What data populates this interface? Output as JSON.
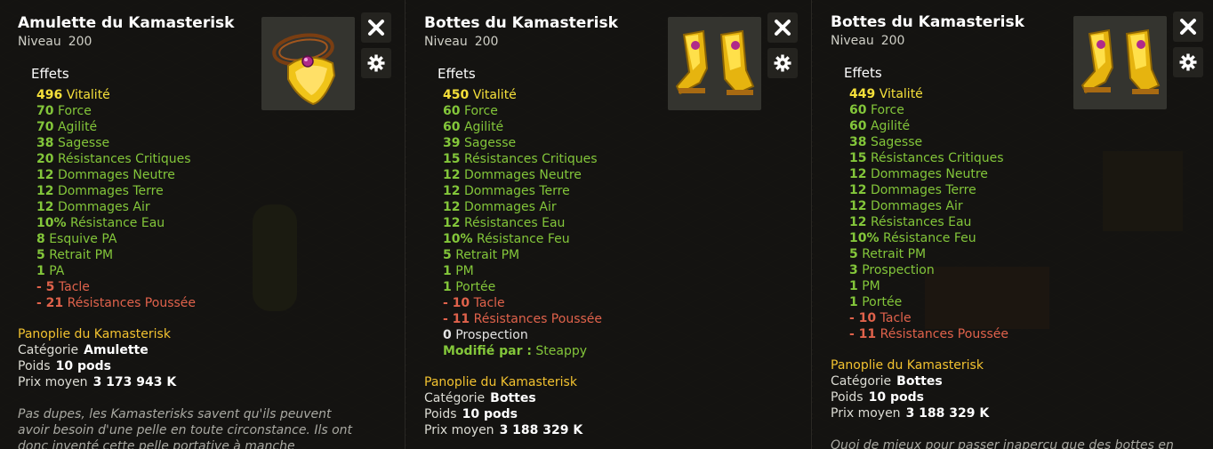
{
  "colors": {
    "stat_green": "#83c63a",
    "vitality_yellow": "#f5e03a",
    "malus_red": "#e0624b",
    "set_gold": "#f2c230"
  },
  "tooltips": [
    {
      "name": "Amulette du Kamasterisk",
      "level_label": "Niveau",
      "level": "200",
      "effects_label": "Effets",
      "icon": "golden-amulet-icon",
      "effects": [
        {
          "value": "496",
          "label": "Vitalité",
          "color": "yellow"
        },
        {
          "value": "70",
          "label": "Force",
          "color": "green"
        },
        {
          "value": "70",
          "label": "Agilité",
          "color": "green"
        },
        {
          "value": "38",
          "label": "Sagesse",
          "color": "green"
        },
        {
          "value": "20",
          "label": "Résistances Critiques",
          "color": "green"
        },
        {
          "value": "12",
          "label": "Dommages Neutre",
          "color": "green"
        },
        {
          "value": "12",
          "label": "Dommages Terre",
          "color": "green"
        },
        {
          "value": "12",
          "label": "Dommages Air",
          "color": "green"
        },
        {
          "value": "10%",
          "label": "Résistance Eau",
          "color": "green"
        },
        {
          "value": "8",
          "label": "Esquive PA",
          "color": "green"
        },
        {
          "value": "5",
          "label": "Retrait PM",
          "color": "green"
        },
        {
          "value": "1",
          "label": "PA",
          "color": "green"
        },
        {
          "value": "- 5",
          "label": "Tacle",
          "color": "red"
        },
        {
          "value": "- 21",
          "label": "Résistances Poussée",
          "color": "red"
        }
      ],
      "set_name": "Panoplie du Kamasterisk",
      "category_label": "Catégorie",
      "category": "Amulette",
      "weight_label": "Poids",
      "weight": "10 pods",
      "price_label": "Prix moyen",
      "price": "3 173 943 K",
      "description": "Pas dupes, les Kamasterisks savent qu'ils peuvent avoir besoin d'une pelle en toute circonstance. Ils ont donc inventé cette pelle portative à manche rétractable pour ne"
    },
    {
      "name": "Bottes du Kamasterisk",
      "level_label": "Niveau",
      "level": "200",
      "effects_label": "Effets",
      "icon": "golden-boots-icon",
      "effects": [
        {
          "value": "450",
          "label": "Vitalité",
          "color": "yellow"
        },
        {
          "value": "60",
          "label": "Force",
          "color": "green"
        },
        {
          "value": "60",
          "label": "Agilité",
          "color": "green"
        },
        {
          "value": "39",
          "label": "Sagesse",
          "color": "green"
        },
        {
          "value": "15",
          "label": "Résistances Critiques",
          "color": "green"
        },
        {
          "value": "12",
          "label": "Dommages Neutre",
          "color": "green"
        },
        {
          "value": "12",
          "label": "Dommages Terre",
          "color": "green"
        },
        {
          "value": "12",
          "label": "Dommages Air",
          "color": "green"
        },
        {
          "value": "12",
          "label": "Résistances Eau",
          "color": "green"
        },
        {
          "value": "10%",
          "label": "Résistance Feu",
          "color": "green"
        },
        {
          "value": "5",
          "label": "Retrait PM",
          "color": "green"
        },
        {
          "value": "1",
          "label": "PM",
          "color": "green"
        },
        {
          "value": "1",
          "label": "Portée",
          "color": "green"
        },
        {
          "value": "- 10",
          "label": "Tacle",
          "color": "red"
        },
        {
          "value": "- 11",
          "label": "Résistances Poussée",
          "color": "red"
        },
        {
          "value": "0",
          "label": "Prospection",
          "color": "white"
        },
        {
          "value": "Modifié par :",
          "label": "Steappy",
          "color": "green"
        }
      ],
      "set_name": "Panoplie du Kamasterisk",
      "category_label": "Catégorie",
      "category": "Bottes",
      "weight_label": "Poids",
      "weight": "10 pods",
      "price_label": "Prix moyen",
      "price": "3 188 329 K",
      "description": ""
    },
    {
      "name": "Bottes du Kamasterisk",
      "level_label": "Niveau",
      "level": "200",
      "effects_label": "Effets",
      "icon": "golden-boots-icon",
      "effects": [
        {
          "value": "449",
          "label": "Vitalité",
          "color": "yellow"
        },
        {
          "value": "60",
          "label": "Force",
          "color": "green"
        },
        {
          "value": "60",
          "label": "Agilité",
          "color": "green"
        },
        {
          "value": "38",
          "label": "Sagesse",
          "color": "green"
        },
        {
          "value": "15",
          "label": "Résistances Critiques",
          "color": "green"
        },
        {
          "value": "12",
          "label": "Dommages Neutre",
          "color": "green"
        },
        {
          "value": "12",
          "label": "Dommages Terre",
          "color": "green"
        },
        {
          "value": "12",
          "label": "Dommages Air",
          "color": "green"
        },
        {
          "value": "12",
          "label": "Résistances Eau",
          "color": "green"
        },
        {
          "value": "10%",
          "label": "Résistance Feu",
          "color": "green"
        },
        {
          "value": "5",
          "label": "Retrait PM",
          "color": "green"
        },
        {
          "value": "3",
          "label": "Prospection",
          "color": "green"
        },
        {
          "value": "1",
          "label": "PM",
          "color": "green"
        },
        {
          "value": "1",
          "label": "Portée",
          "color": "green"
        },
        {
          "value": "- 10",
          "label": "Tacle",
          "color": "red"
        },
        {
          "value": "- 11",
          "label": "Résistances Poussée",
          "color": "red"
        }
      ],
      "set_name": "Panoplie du Kamasterisk",
      "category_label": "Catégorie",
      "category": "Bottes",
      "weight_label": "Poids",
      "weight": "10 pods",
      "price_label": "Prix moyen",
      "price": "3 188 329 K",
      "description": "Quoi de mieux pour passer inaperçu que des bottes en or"
    }
  ]
}
